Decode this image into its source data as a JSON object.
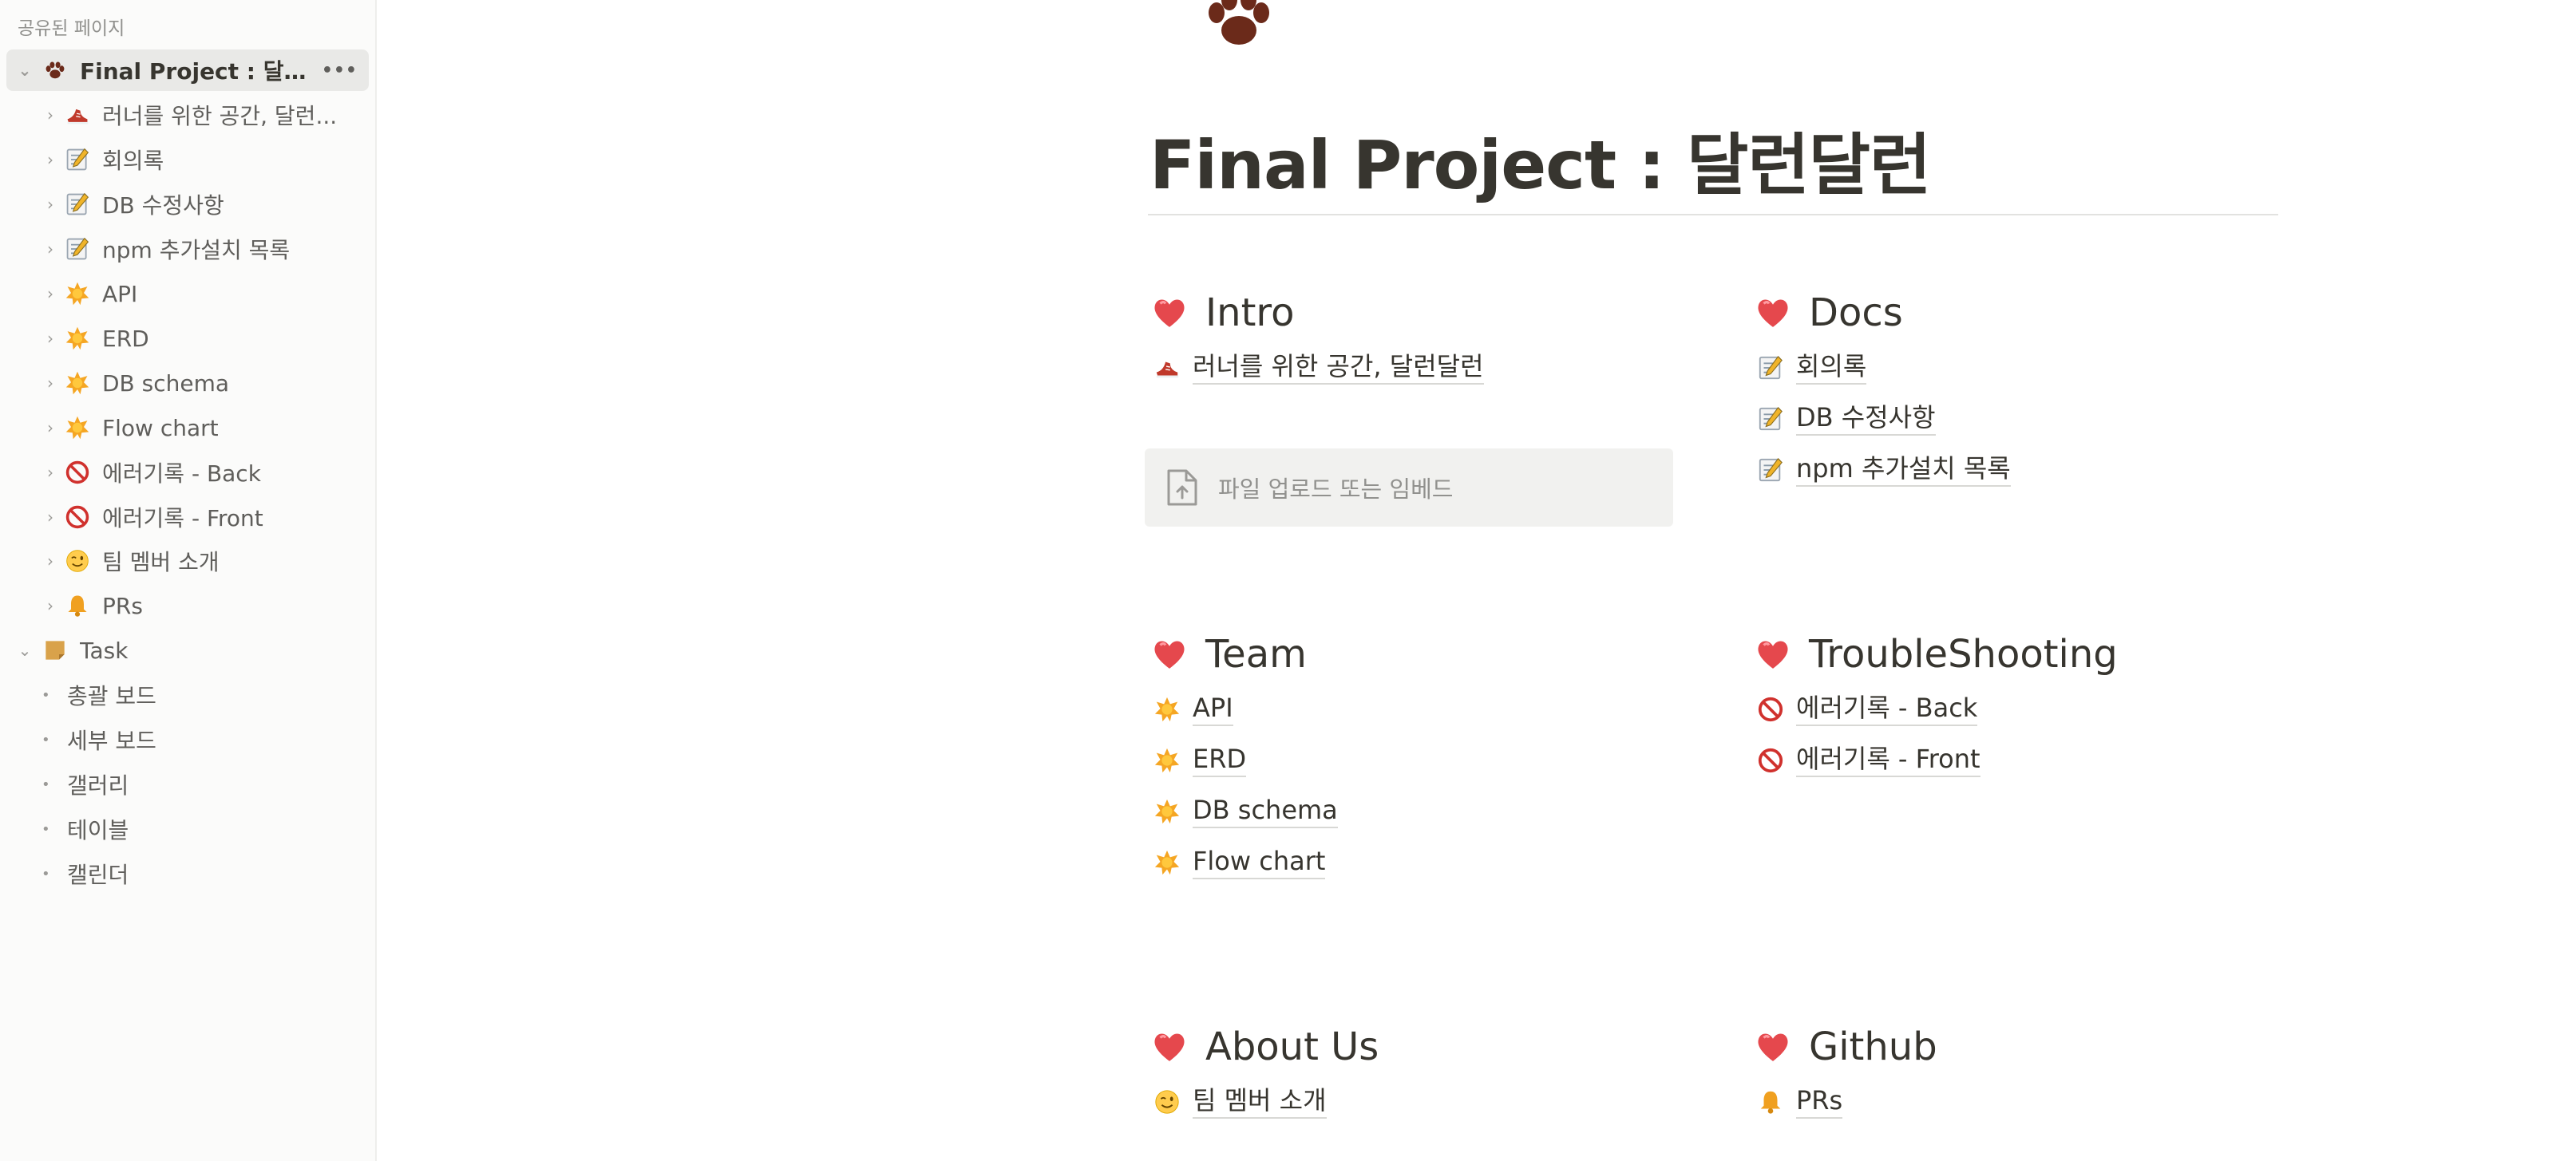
{
  "sidebar": {
    "heading": "공유된 페이지",
    "root": {
      "label": "Final Project : 달런달...",
      "more": "•••"
    },
    "children": [
      {
        "label": "러너를 위한 공간, 달런...",
        "icon": "shoe-icon"
      },
      {
        "label": "회의록",
        "icon": "memo-icon"
      },
      {
        "label": "DB 수정사항",
        "icon": "memo-icon"
      },
      {
        "label": "npm 추가설치 목록",
        "icon": "memo-icon"
      },
      {
        "label": "API",
        "icon": "star-icon"
      },
      {
        "label": "ERD",
        "icon": "star-icon"
      },
      {
        "label": "DB schema",
        "icon": "star-icon"
      },
      {
        "label": "Flow chart",
        "icon": "star-icon"
      },
      {
        "label": "에러기록 - Back",
        "icon": "prohibited-icon"
      },
      {
        "label": "에러기록 - Front",
        "icon": "prohibited-icon"
      },
      {
        "label": "팀 멤버 소개",
        "icon": "wink-face-icon"
      },
      {
        "label": "PRs",
        "icon": "bell-icon"
      }
    ],
    "task": {
      "label": "Task",
      "icon": "note-icon",
      "views": [
        "총괄 보드",
        "세부 보드",
        "갤러리",
        "테이블",
        "캘린더"
      ]
    }
  },
  "page": {
    "icon": "paw-icon",
    "title": "Final Project : 달런달런",
    "sections": {
      "intro": {
        "title": "Intro",
        "links": [
          {
            "label": "러너를 위한 공간, 달런달런",
            "icon": "shoe-icon"
          }
        ]
      },
      "upload": {
        "label": "파일 업로드 또는 임베드"
      },
      "docs": {
        "title": "Docs",
        "links": [
          {
            "label": "회의록",
            "icon": "memo-icon"
          },
          {
            "label": "DB 수정사항",
            "icon": "memo-icon"
          },
          {
            "label": "npm 추가설치 목록",
            "icon": "memo-icon"
          }
        ]
      },
      "team": {
        "title": "Team",
        "links": [
          {
            "label": "API",
            "icon": "star-icon"
          },
          {
            "label": "ERD",
            "icon": "star-icon"
          },
          {
            "label": "DB schema",
            "icon": "star-icon"
          },
          {
            "label": "Flow chart",
            "icon": "star-icon"
          }
        ]
      },
      "troubleshooting": {
        "title": "TroubleShooting",
        "links": [
          {
            "label": "에러기록 - Back",
            "icon": "prohibited-icon"
          },
          {
            "label": "에러기록 - Front",
            "icon": "prohibited-icon"
          }
        ]
      },
      "about": {
        "title": "About Us",
        "links": [
          {
            "label": "팀 멤버 소개",
            "icon": "wink-face-icon"
          }
        ]
      },
      "github": {
        "title": "Github",
        "links": [
          {
            "label": "PRs",
            "icon": "bell-icon"
          }
        ]
      }
    }
  },
  "colors": {
    "heart": "#e5484d",
    "star": "#f5a623",
    "prohibited": "#d0312d",
    "bell": "#f0a020",
    "sidebar_bg": "#fbfbfa"
  }
}
